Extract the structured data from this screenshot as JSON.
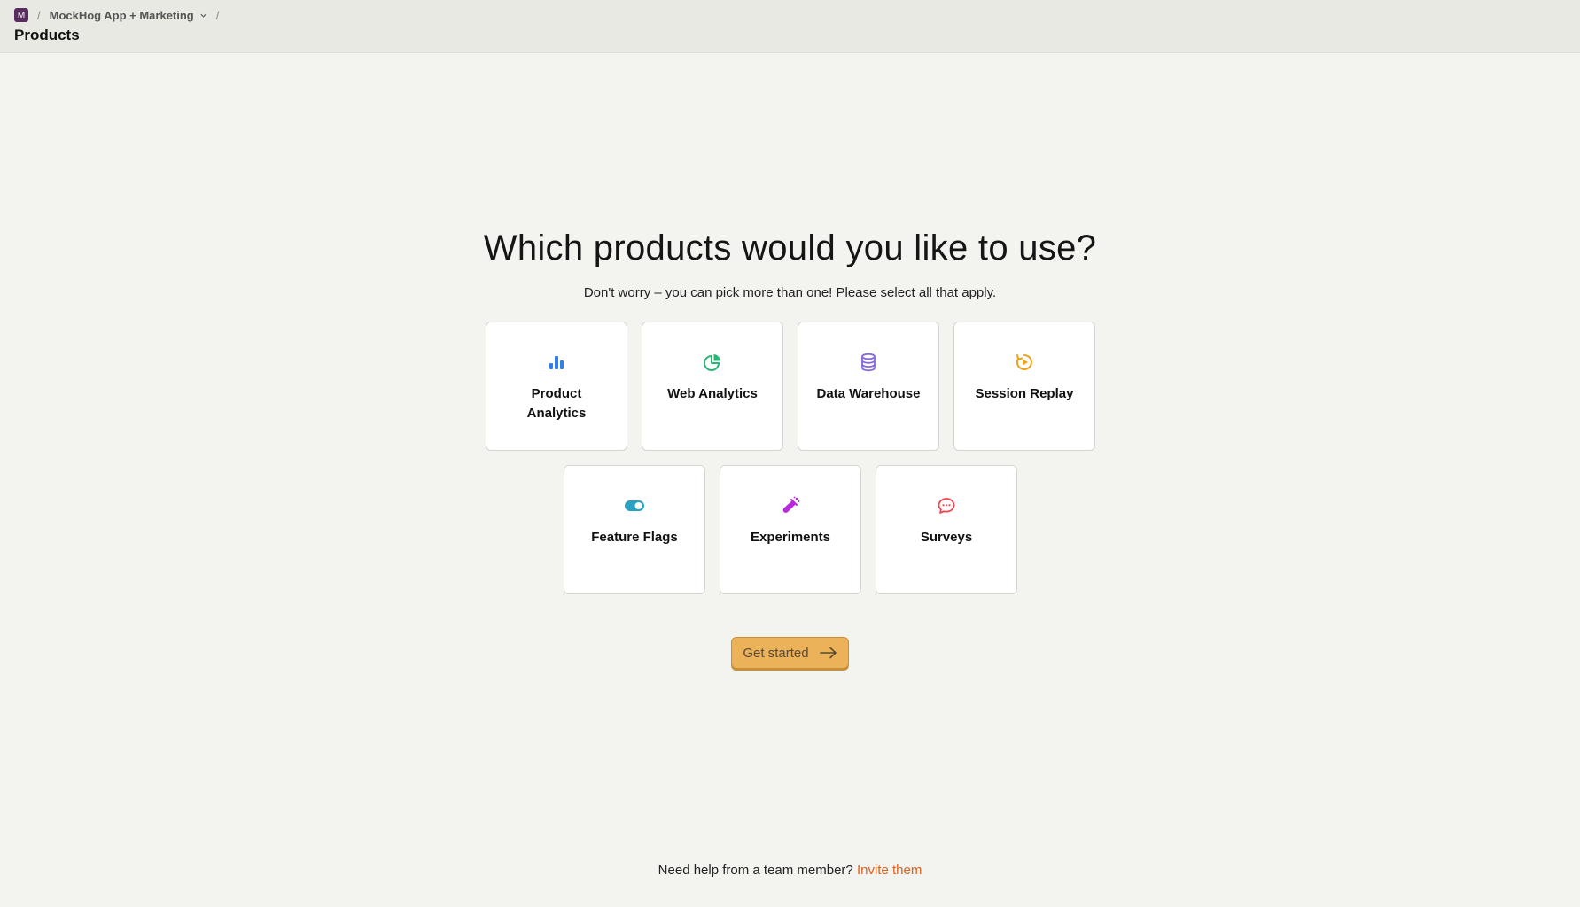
{
  "header": {
    "org_avatar_letter": "M",
    "separator": "/",
    "project_name": "MockHog App + Marketing",
    "page_title": "Products"
  },
  "main": {
    "headline": "Which products would you like to use?",
    "subheadline": "Don't worry – you can pick more than one! Please select all that apply.",
    "products": [
      {
        "label": "Product Analytics",
        "icon": "bar-chart-icon",
        "color": "#2f80ed"
      },
      {
        "label": "Web Analytics",
        "icon": "pie-chart-icon",
        "color": "#2bb673"
      },
      {
        "label": "Data Warehouse",
        "icon": "database-icon",
        "color": "#8567e0"
      },
      {
        "label": "Session Replay",
        "icon": "replay-icon",
        "color": "#f0a11a"
      },
      {
        "label": "Feature Flags",
        "icon": "toggle-icon",
        "color": "#2aa1c0"
      },
      {
        "label": "Experiments",
        "icon": "flask-icon",
        "color": "#b62ad9"
      },
      {
        "label": "Surveys",
        "icon": "chat-bubble-icon",
        "color": "#f0474f"
      }
    ],
    "cta_label": "Get started"
  },
  "footer": {
    "help_text": "Need help from a team member?",
    "invite_link": "Invite them"
  },
  "colors": {
    "accent": "#ecb25a",
    "link": "#e0601b",
    "background": "#f3f3ef"
  }
}
